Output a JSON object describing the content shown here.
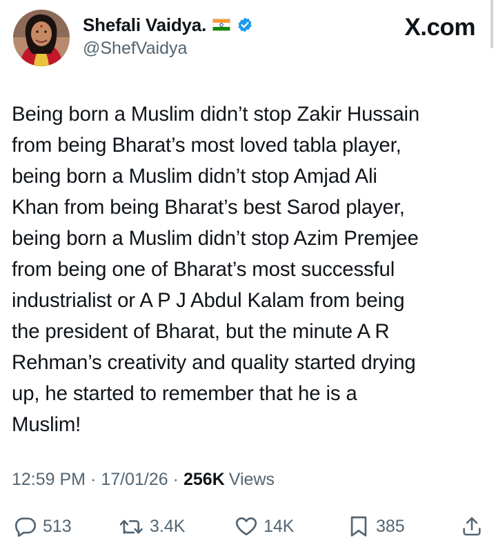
{
  "author": {
    "display_name": "Shefali Vaidya.",
    "handle": "@ShefVaidya",
    "flag_icon": "india-flag-icon",
    "verified_icon": "verified-badge-icon"
  },
  "brand": "X.com",
  "tweet": {
    "text": "Being born a Muslim didn’t stop Zakir Hussain\nfrom being Bharat’s most loved tabla player,\nbeing born a Muslim didn’t stop Amjad Ali\nKhan from being Bharat’s best Sarod player,\nbeing born a Muslim didn’t stop Azim Premjee\nfrom being one of Bharat’s most successful\nindustrialist or A P J Abdul Kalam from being\nthe president of Bharat, but the minute A R\nRehman’s creativity and quality started drying\nup, he started to remember that he is a\nMuslim!"
  },
  "meta": {
    "time": "12:59 PM",
    "separator": "·",
    "date": "17/01/26",
    "views_count": "256K",
    "views_label": "Views"
  },
  "actions": {
    "replies": "513",
    "reposts": "3.4K",
    "likes": "14K",
    "bookmarks": "385"
  },
  "colors": {
    "text": "#0f1419",
    "secondary": "#536471",
    "verified": "#1d9bf0"
  }
}
